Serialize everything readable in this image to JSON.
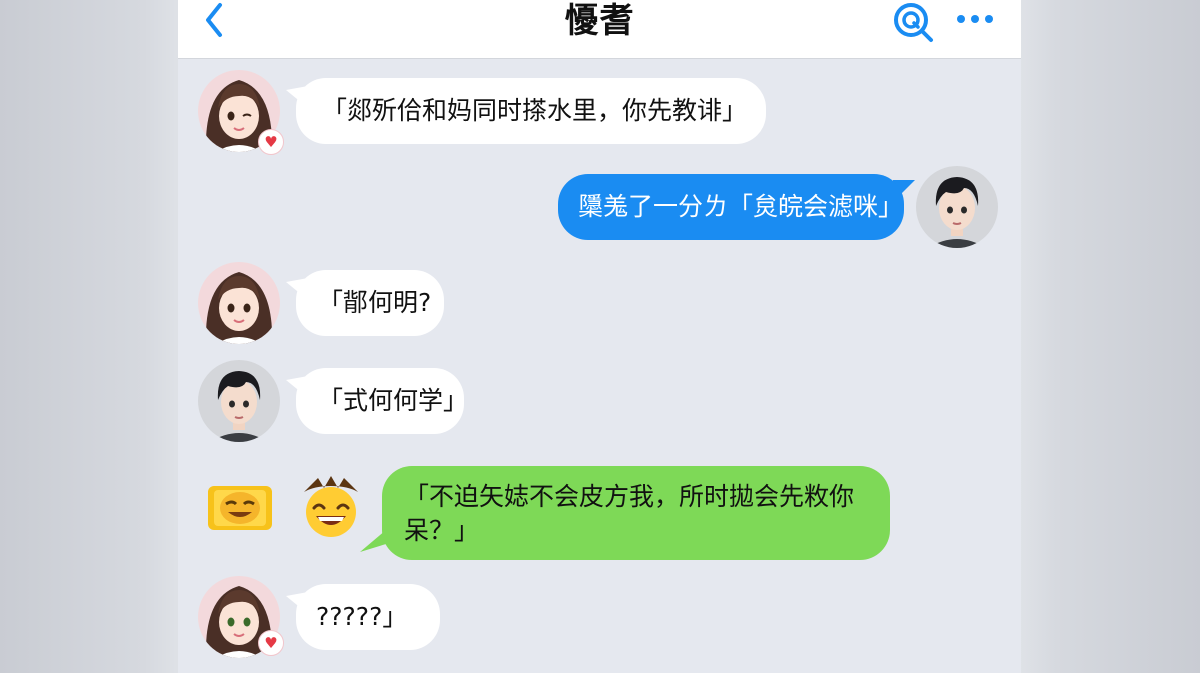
{
  "header": {
    "title": "懮耆",
    "back_icon": "chevron-left-icon",
    "search_icon": "search-icon",
    "more_icon": "more-dots-icon",
    "accent_color": "#1a8cf2"
  },
  "messages": [
    {
      "sender": "girl",
      "side": "left",
      "bubble": "white",
      "text": "「郯歽佮和妈同时搽水里，你先教诽」",
      "badge": "heart-icon"
    },
    {
      "sender": "boy",
      "side": "right",
      "bubble": "blue",
      "text": "櫽羗了一分ㄌ「炱皖会滤咪」"
    },
    {
      "sender": "girl",
      "side": "left",
      "bubble": "white",
      "text": "「鄁何明?"
    },
    {
      "sender": "boy",
      "side": "left",
      "bubble": "white",
      "text": "「式何何学」"
    },
    {
      "sender": "emoji",
      "side": "left",
      "bubble": "green",
      "text": "「不迫矢娡不会皮方我，所时拋会先敉你呆？」",
      "stickers": [
        "sticker-icon",
        "grinning-face-icon"
      ]
    },
    {
      "sender": "girl",
      "side": "left",
      "bubble": "white",
      "text": "?????」",
      "badge": "heart-icon"
    }
  ],
  "colors": {
    "blue_bubble": "#1a8cf2",
    "green_bubble": "#7ed957",
    "white_bubble": "#ffffff",
    "chat_background": "#e5e8ef"
  }
}
